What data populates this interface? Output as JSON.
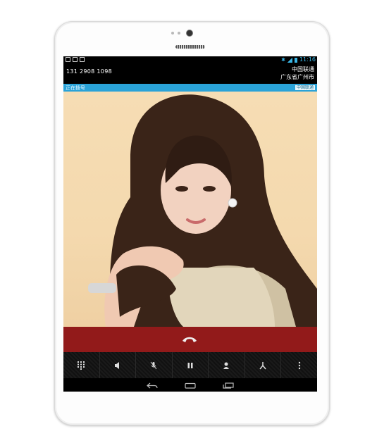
{
  "status_bar": {
    "time": "11:16"
  },
  "call": {
    "number": "131 2908 1098",
    "carrier": "中国联通",
    "location": "广东省广州市",
    "state": "正在拨号",
    "provider_tag": "中国联通"
  },
  "colors": {
    "accent": "#2aa3d8",
    "end_call": "#921a1a"
  },
  "controls": [
    {
      "icon": "dialpad-icon"
    },
    {
      "icon": "speaker-icon"
    },
    {
      "icon": "mute-icon"
    },
    {
      "icon": "hold-icon"
    },
    {
      "icon": "add-call-icon"
    },
    {
      "icon": "merge-call-icon"
    },
    {
      "icon": "more-icon"
    }
  ],
  "nav": [
    {
      "icon": "back-icon"
    },
    {
      "icon": "home-icon"
    },
    {
      "icon": "recents-icon"
    }
  ]
}
